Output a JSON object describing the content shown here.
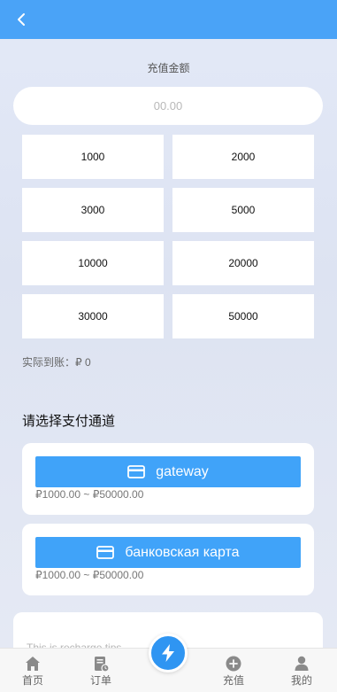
{
  "header": {
    "back_icon": "chevron-left-icon"
  },
  "recharge": {
    "title": "充值金额",
    "placeholder": "00.00",
    "amounts": [
      "1000",
      "2000",
      "3000",
      "5000",
      "10000",
      "20000",
      "30000",
      "50000"
    ],
    "actual_label": "实际到账：₽ 0"
  },
  "channels": {
    "title": "请选择支付通道",
    "items": [
      {
        "name": "gateway",
        "icon": "card-icon",
        "range": "₽1000.00 ~ ₽50000.00"
      },
      {
        "name": "банковская карта",
        "icon": "card-icon",
        "range": "₽1000.00 ~ ₽50000.00"
      }
    ]
  },
  "tips": {
    "text": "This is recharge tips"
  },
  "tabbar": {
    "items": [
      {
        "label": "首页",
        "icon": "home-icon"
      },
      {
        "label": "订单",
        "icon": "order-icon"
      },
      {
        "label": "",
        "icon": "lightning-icon"
      },
      {
        "label": "充值",
        "icon": "plus-circle-icon"
      },
      {
        "label": "我的",
        "icon": "user-icon"
      }
    ]
  },
  "colors": {
    "primary": "#40a3f9",
    "header": "#4aa3f7",
    "tab_icon": "#8a8a8a"
  }
}
